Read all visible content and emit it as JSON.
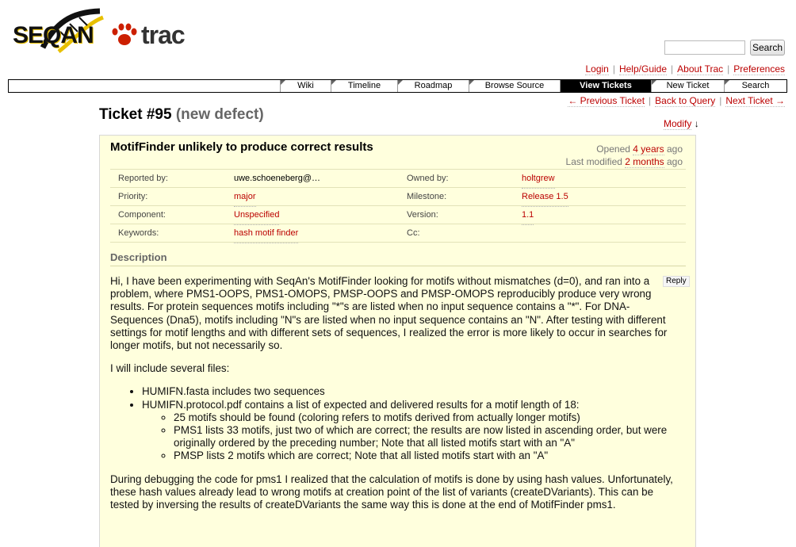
{
  "logo": {
    "text_seqan": "SEQAN",
    "text_trac": "trac"
  },
  "search": {
    "placeholder": "",
    "button_label": "Search"
  },
  "metanav": {
    "items": [
      "Login",
      "Help/Guide",
      "About Trac",
      "Preferences"
    ]
  },
  "mainnav": {
    "tabs": [
      "Wiki",
      "Timeline",
      "Roadmap",
      "Browse Source",
      "View Tickets",
      "New Ticket",
      "Search"
    ],
    "active": "View Tickets"
  },
  "ctxtnav": {
    "previous": "← Previous Ticket",
    "back": "Back to Query",
    "next": "Next Ticket →"
  },
  "ticket": {
    "number": "Ticket #95",
    "status": "(new defect)",
    "modify_label": "Modify",
    "modify_arrow": "↓",
    "summary": "MotifFinder unlikely to produce correct results",
    "opened_prefix": "Opened",
    "opened_link": "4 years",
    "opened_suffix": "ago",
    "modified_prefix": "Last modified",
    "modified_link": "2 months",
    "modified_suffix": "ago",
    "props": {
      "reported_by_label": "Reported by:",
      "reported_by": "uwe.schoeneberg@…",
      "owned_by_label": "Owned by:",
      "owned_by": "holtgrew",
      "priority_label": "Priority:",
      "priority": "major",
      "milestone_label": "Milestone:",
      "milestone": "Release 1.5",
      "component_label": "Component:",
      "component": "Unspecified",
      "version_label": "Version:",
      "version": "1.1",
      "keywords_label": "Keywords:",
      "keywords": "hash motif finder",
      "cc_label": "Cc:",
      "cc": ""
    },
    "description_heading": "Description",
    "reply_label": "Reply",
    "description": {
      "p1": "Hi, I have been experimenting with SeqAn's MotifFinder looking for motifs without mismatches (d=0), and ran into a problem, where PMS1-OOPS, PMS1-OMOPS, PMSP-OOPS and PMSP-OMOPS reproducibly produce very wrong results. For protein sequences motifs including \"*\"s are listed when no input sequence contains a \"*\". For DNA-Sequences (Dna5), motifs including \"N\"s are listed when no input sequence contains an \"N\". After testing with different settings for motif lengths and with different sets of sequences, I realized the error is more likely to occur in searches for longer motifs, but not necessarily so.",
      "p2": "I will include several files:",
      "li1": "HUMIFN.fasta includes two sequences",
      "li2": "HUMIFN.protocol.pdf contains a list of expected and delivered results for a motif length of 18:",
      "li2a": "25 motifs should be found (coloring refers to motifs derived from actually longer motifs)",
      "li2b": "PMS1 lists 33 motifs, just two of which are correct; the results are now listed in ascending order, but were originally ordered by the preceding number; Note that all listed motifs start with an \"A\"",
      "li2c": "PMSP lists 2 motifs which are correct; Note that all listed motifs start with an \"A\"",
      "p3": "During debugging the code for pms1 I realized that the calculation of motifs is done by using hash values. Unfortunately, these hash values already lead to wrong motifs at creation point of the list of variants (createDVariants). This can be tested by inversing the results of createDVariants the same way this is done at the end of MotifFinder pms1."
    }
  }
}
